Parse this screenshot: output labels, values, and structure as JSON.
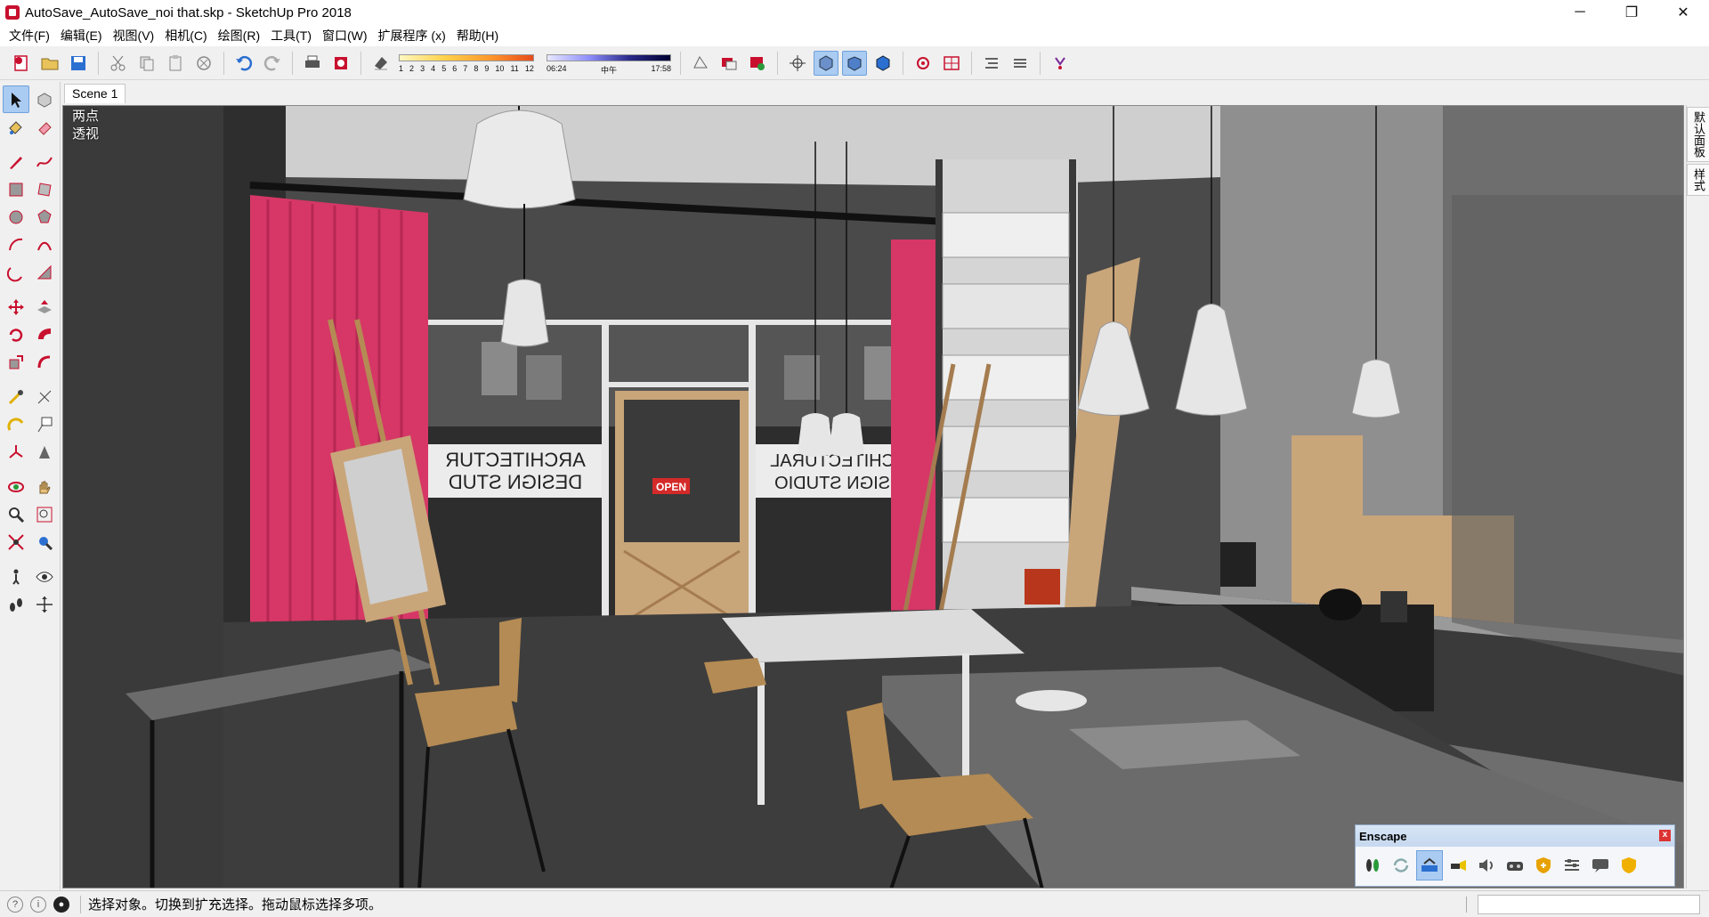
{
  "window": {
    "title": "AutoSave_AutoSave_noi that.skp - SketchUp Pro 2018",
    "minimize": "─",
    "maximize": "❐",
    "close": "✕"
  },
  "menu": {
    "items": [
      "文件(F)",
      "编辑(E)",
      "视图(V)",
      "相机(C)",
      "绘图(R)",
      "工具(T)",
      "窗口(W)",
      "扩展程序 (x)",
      "帮助(H)"
    ]
  },
  "toolbar": {
    "shadow_months": [
      "1",
      "2",
      "3",
      "4",
      "5",
      "6",
      "7",
      "8",
      "9",
      "10",
      "11",
      "12"
    ],
    "time_start": "06:24",
    "time_mid": "中午",
    "time_end": "17:58"
  },
  "scene": {
    "tab_label": "Scene 1",
    "view_label_line1": "两点",
    "view_label_line2": "透视",
    "window_text_left_1": "ARCHITECTUR",
    "window_text_left_2": "DESIGN STUD",
    "window_text_right_1": "ARCHITECTURAL",
    "window_text_right_2": "DESIGN STUDIO",
    "door_sign": "OPEN"
  },
  "right_panel": {
    "tab1": "默认面板",
    "tab2": "样式"
  },
  "enscape": {
    "title": "Enscape",
    "close": "x"
  },
  "status": {
    "text": "选择对象。切换到扩充选择。拖动鼠标选择多项。"
  },
  "colors": {
    "curtain": "#d63766",
    "accent_blue": "#2b6fd0",
    "sketchup_red": "#c8102e"
  }
}
